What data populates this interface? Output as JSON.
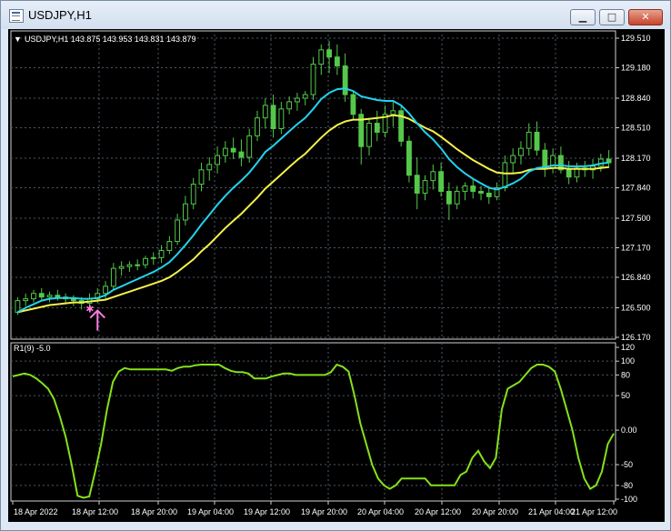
{
  "window": {
    "title": "USDJPY,H1",
    "minimize_glyph": "▁",
    "maximize_glyph": "□",
    "close_glyph": "✕"
  },
  "header": {
    "symbol_line": "USDJPY,H1  143.875 143.953 143.831 143.879"
  },
  "indicator": {
    "label": "R1(9) -5.0"
  },
  "colors": {
    "bg": "#000000",
    "grid": "#4a5a6a",
    "bull": "#55c84a",
    "ma_fast": "#22d3ee",
    "ma_slow": "#f5f04a",
    "indicator": "#84e11a",
    "arrow": "#ff7be0"
  },
  "chart_data": [
    {
      "type": "candlestick",
      "price_ticks": [
        "129.510",
        "129.180",
        "128.840",
        "128.510",
        "128.170",
        "127.840",
        "127.500",
        "127.170",
        "126.840",
        "126.500",
        "126.170"
      ],
      "ylim": [
        126.17,
        129.51
      ],
      "time_labels": [
        "18 Apr 2022",
        "18 Apr 12:00",
        "18 Apr 20:00",
        "19 Apr 04:00",
        "19 Apr 12:00",
        "19 Apr 20:00",
        "20 Apr 04:00",
        "20 Apr 12:00",
        "20 Apr 20:00",
        "21 Apr 04:00",
        "21 Apr 12:00"
      ],
      "candles": [
        [
          126.45,
          126.62,
          126.42,
          126.58
        ],
        [
          126.58,
          126.66,
          126.52,
          126.6
        ],
        [
          126.6,
          126.7,
          126.56,
          126.66
        ],
        [
          126.66,
          126.72,
          126.58,
          126.62
        ],
        [
          126.62,
          126.68,
          126.56,
          126.64
        ],
        [
          126.64,
          126.7,
          126.58,
          126.62
        ],
        [
          126.62,
          126.66,
          126.55,
          126.6
        ],
        [
          126.6,
          126.64,
          126.52,
          126.58
        ],
        [
          126.58,
          126.62,
          126.48,
          126.55
        ],
        [
          126.55,
          126.66,
          126.5,
          126.6
        ],
        [
          126.6,
          126.72,
          126.55,
          126.66
        ],
        [
          126.66,
          126.8,
          126.6,
          126.74
        ],
        [
          126.74,
          127.0,
          126.7,
          126.94
        ],
        [
          126.94,
          127.02,
          126.86,
          126.96
        ],
        [
          126.96,
          127.02,
          126.9,
          126.98
        ],
        [
          126.98,
          127.04,
          126.92,
          126.98
        ],
        [
          126.98,
          127.08,
          126.94,
          127.05
        ],
        [
          127.05,
          127.12,
          126.98,
          127.06
        ],
        [
          127.06,
          127.2,
          127.0,
          127.14
        ],
        [
          127.14,
          127.3,
          127.1,
          127.24
        ],
        [
          127.24,
          127.55,
          127.2,
          127.48
        ],
        [
          127.48,
          127.75,
          127.42,
          127.66
        ],
        [
          127.66,
          127.95,
          127.6,
          127.88
        ],
        [
          127.88,
          128.12,
          127.8,
          128.04
        ],
        [
          128.04,
          128.18,
          127.92,
          128.1
        ],
        [
          128.1,
          128.3,
          128.0,
          128.2
        ],
        [
          128.2,
          128.36,
          128.12,
          128.28
        ],
        [
          128.28,
          128.4,
          128.16,
          128.24
        ],
        [
          128.24,
          128.38,
          128.08,
          128.18
        ],
        [
          128.18,
          128.5,
          128.12,
          128.42
        ],
        [
          128.42,
          128.7,
          128.36,
          128.62
        ],
        [
          128.62,
          128.84,
          128.5,
          128.76
        ],
        [
          128.76,
          128.88,
          128.4,
          128.5
        ],
        [
          128.5,
          128.8,
          128.44,
          128.72
        ],
        [
          128.72,
          128.86,
          128.66,
          128.8
        ],
        [
          128.8,
          128.9,
          128.7,
          128.84
        ],
        [
          128.84,
          128.92,
          128.76,
          128.88
        ],
        [
          128.88,
          129.3,
          128.82,
          129.22
        ],
        [
          129.22,
          129.44,
          129.1,
          129.38
        ],
        [
          129.38,
          129.48,
          129.12,
          129.3
        ],
        [
          129.3,
          129.44,
          129.1,
          129.2
        ],
        [
          129.2,
          129.34,
          128.8,
          128.88
        ],
        [
          128.88,
          128.92,
          128.6,
          128.66
        ],
        [
          128.66,
          128.72,
          128.1,
          128.3
        ],
        [
          128.3,
          128.62,
          128.2,
          128.56
        ],
        [
          128.56,
          128.7,
          128.36,
          128.46
        ],
        [
          128.46,
          128.76,
          128.4,
          128.66
        ],
        [
          128.66,
          128.8,
          128.52,
          128.7
        ],
        [
          128.7,
          128.76,
          128.3,
          128.36
        ],
        [
          128.36,
          128.42,
          127.9,
          127.98
        ],
        [
          127.98,
          128.18,
          127.6,
          127.78
        ],
        [
          127.78,
          127.98,
          127.7,
          127.92
        ],
        [
          127.92,
          128.1,
          127.82,
          128.02
        ],
        [
          128.02,
          128.12,
          127.74,
          127.8
        ],
        [
          127.8,
          127.9,
          127.48,
          127.66
        ],
        [
          127.66,
          127.86,
          127.6,
          127.8
        ],
        [
          127.8,
          127.9,
          127.7,
          127.86
        ],
        [
          127.86,
          127.94,
          127.72,
          127.8
        ],
        [
          127.8,
          127.86,
          127.7,
          127.78
        ],
        [
          127.78,
          127.86,
          127.66,
          127.74
        ],
        [
          127.74,
          127.9,
          127.7,
          127.84
        ],
        [
          127.84,
          128.2,
          127.8,
          128.12
        ],
        [
          128.12,
          128.28,
          128.0,
          128.2
        ],
        [
          128.2,
          128.36,
          128.1,
          128.28
        ],
        [
          128.28,
          128.56,
          128.2,
          128.46
        ],
        [
          128.46,
          128.58,
          128.2,
          128.26
        ],
        [
          128.26,
          128.34,
          127.96,
          128.06
        ],
        [
          128.06,
          128.28,
          128.0,
          128.2
        ],
        [
          128.2,
          128.3,
          128.0,
          128.04
        ],
        [
          128.04,
          128.14,
          127.88,
          127.96
        ],
        [
          127.96,
          128.12,
          127.9,
          128.06
        ],
        [
          128.06,
          128.14,
          127.96,
          128.04
        ],
        [
          128.04,
          128.16,
          127.94,
          128.08
        ],
        [
          128.08,
          128.22,
          128.02,
          128.16
        ],
        [
          128.16,
          128.26,
          128.06,
          128.12
        ]
      ],
      "ma_fast": [
        126.45,
        126.5,
        126.54,
        126.58,
        126.6,
        126.61,
        126.61,
        126.61,
        126.6,
        126.6,
        126.61,
        126.64,
        126.7,
        126.74,
        126.78,
        126.82,
        126.86,
        126.9,
        126.95,
        127.01,
        127.1,
        127.2,
        127.31,
        127.43,
        127.54,
        127.65,
        127.75,
        127.84,
        127.92,
        128.01,
        128.12,
        128.24,
        128.31,
        128.39,
        128.47,
        128.55,
        128.62,
        128.72,
        128.83,
        128.9,
        128.94,
        128.95,
        128.92,
        128.86,
        128.84,
        128.82,
        128.81,
        128.81,
        128.76,
        128.67,
        128.56,
        128.46,
        128.38,
        128.28,
        128.16,
        128.07,
        128.0,
        127.94,
        127.89,
        127.84,
        127.82,
        127.85,
        127.89,
        127.94,
        128.02,
        128.06,
        128.07,
        128.09,
        128.09,
        128.08,
        128.08,
        128.08,
        128.09,
        128.11,
        128.12
      ],
      "ma_slow": [
        126.45,
        126.47,
        126.49,
        126.51,
        126.53,
        126.54,
        126.55,
        126.56,
        126.56,
        126.57,
        126.58,
        126.59,
        126.62,
        126.65,
        126.68,
        126.71,
        126.74,
        126.77,
        126.8,
        126.84,
        126.9,
        126.97,
        127.04,
        127.13,
        127.21,
        127.3,
        127.39,
        127.47,
        127.55,
        127.64,
        127.73,
        127.83,
        127.91,
        127.99,
        128.07,
        128.15,
        128.22,
        128.31,
        128.4,
        128.48,
        128.54,
        128.58,
        128.6,
        128.6,
        128.61,
        128.62,
        128.63,
        128.65,
        128.64,
        128.61,
        128.56,
        128.51,
        128.47,
        128.41,
        128.34,
        128.27,
        128.21,
        128.15,
        128.1,
        128.05,
        128.01,
        128.0,
        128.0,
        128.01,
        128.04,
        128.05,
        128.05,
        128.06,
        128.06,
        128.05,
        128.05,
        128.05,
        128.05,
        128.06,
        128.07
      ],
      "signal_arrow_index": 10
    },
    {
      "type": "line",
      "name": "R1(9) -5.0",
      "ticks": [
        "120",
        "100",
        "80",
        "50",
        "0.00",
        "-50",
        "-80",
        "-100"
      ],
      "ylim": [
        -100,
        120
      ],
      "values": [
        78,
        80,
        82,
        80,
        75,
        68,
        60,
        45,
        20,
        -10,
        -50,
        -95,
        -98,
        -96,
        -60,
        -20,
        30,
        70,
        85,
        90,
        88,
        88,
        88,
        88,
        88,
        88,
        88,
        86,
        90,
        92,
        92,
        94,
        95,
        95,
        95,
        95,
        90,
        86,
        84,
        84,
        82,
        75,
        75,
        75,
        78,
        80,
        82,
        82,
        80,
        80,
        80,
        80,
        80,
        80,
        84,
        95,
        92,
        85,
        50,
        10,
        -20,
        -50,
        -70,
        -80,
        -85,
        -80,
        -70,
        -70,
        -70,
        -70,
        -70,
        -80,
        -80,
        -80,
        -80,
        -80,
        -65,
        -60,
        -40,
        -30,
        -45,
        -55,
        -40,
        30,
        60,
        65,
        70,
        80,
        90,
        95,
        95,
        92,
        85,
        60,
        30,
        0,
        -40,
        -70,
        -85,
        -80,
        -60,
        -20,
        -5
      ]
    }
  ]
}
